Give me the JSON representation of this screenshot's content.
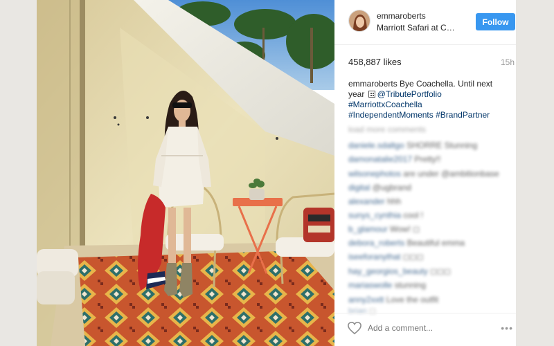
{
  "post": {
    "username": "emmaroberts",
    "location": "Marriott Safari at Coachella",
    "follow_label": "Follow",
    "likes": "458,887 likes",
    "time": "15h",
    "caption": {
      "user": "emmaroberts",
      "text_1": " Bye Coachella. Until next year",
      "mention": "@TributePortfolio",
      "tag_1": "#MarriottxCoachella",
      "tag_2": "#IndependentMoments",
      "tag_3": "#BrandPartner"
    },
    "comments": [
      {
        "user": "load more comments",
        "text": ""
      },
      {
        "user": "daniele.sdaltgo",
        "text": "SHORRE Stunning"
      },
      {
        "user": "damonatalie2017",
        "text": "Pretty!!"
      },
      {
        "user": "wilsonephotos",
        "text": "are under @ambitionbase"
      },
      {
        "user": "digital",
        "text": "@ugbrand"
      },
      {
        "user": "alexander",
        "text": "hhh"
      },
      {
        "user": "sunys_cynthia",
        "text": "cool !"
      },
      {
        "user": "b_glamour",
        "text": "Wow! ◻"
      },
      {
        "user": "debora_roberts",
        "text": "Beautiful emma"
      },
      {
        "user": "iseeforanythat",
        "text": "◻◻◻"
      },
      {
        "user": "hay_georgios_beauty",
        "text": "◻◻◻"
      },
      {
        "user": "mariaswolle",
        "text": "stunning"
      },
      {
        "user": "anny2xxtt",
        "text": "Love the outfit"
      },
      {
        "user": "brian",
        "text": "◻"
      }
    ],
    "add_comment_placeholder": "Add a comment...",
    "more_label": "•••"
  },
  "colors": {
    "follow_button": "#3897f0",
    "link": "#003569",
    "muted": "#999999",
    "page_bg": "#e9e7e3"
  },
  "icons": {
    "like": "heart-outline-icon",
    "options": "more-options-icon"
  }
}
